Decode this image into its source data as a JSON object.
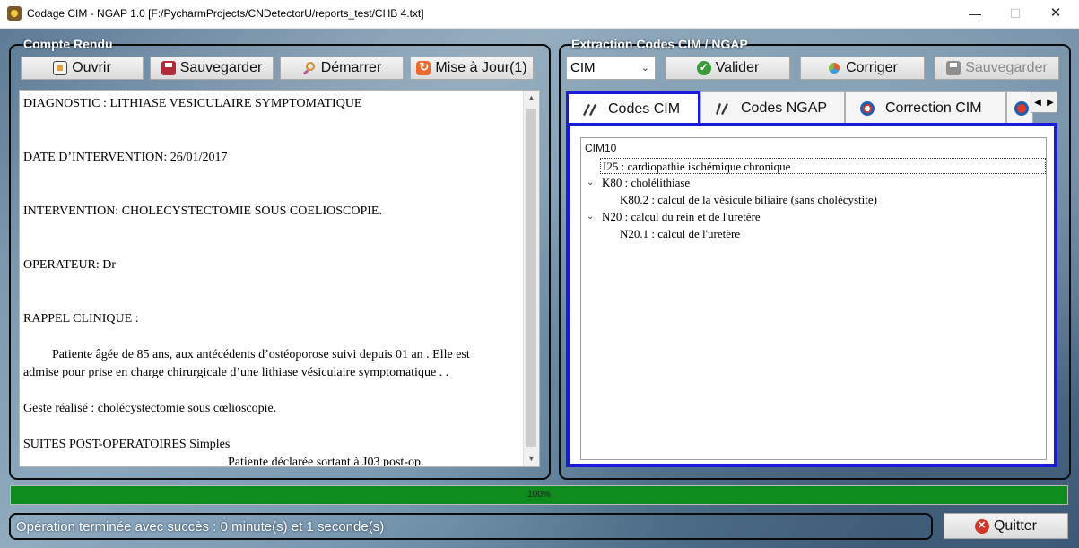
{
  "window": {
    "title": "Codage CIM - NGAP 1.0 [F:/PycharmProjects/CNDetectorU/reports_test/CHB 4.txt]",
    "minimize": "—",
    "maximize": "☐",
    "close": "✕"
  },
  "left_panel": {
    "title": "Compte Rendu",
    "buttons": {
      "open": "Ouvrir",
      "save": "Sauvegarder",
      "start": "Démarrer",
      "update": "Mise à Jour(1)"
    },
    "report_lines": [
      "DIAGNOSTIC : LITHIASE VESICULAIRE SYMPTOMATIQUE",
      "DATE D’INTERVENTION: 26/01/2017",
      "INTERVENTION: CHOLECYSTECTOMIE SOUS COELIOSCOPIE.",
      "OPERATEUR: Dr",
      "RAPPEL CLINIQUE :",
      "Patiente âgée de 85 ans, aux antécédents d’ostéoporose suivi depuis 01 an  . Elle est",
      "admise pour prise en charge chirurgicale d’une lithiase vésiculaire symptomatique .         .",
      "Geste réalisé : cholécystectomie sous cœlioscopie.",
      "SUITES POST-OPERATOIRES Simples",
      "Patiente déclarée sortant à J03 post-op."
    ]
  },
  "right_panel": {
    "title": "Extraction Codes CIM / NGAP",
    "code_type_select": "CIM",
    "buttons": {
      "validate": "Valider",
      "correct": "Corriger",
      "save": "Sauvegarder"
    },
    "tabs": [
      "Codes CIM",
      "Codes NGAP",
      "Correction CIM"
    ],
    "tree": {
      "header": "CIM10",
      "items": [
        "I25 : cardiopathie ischémique chronique",
        "K80 : cholélithiase",
        "K80.2 : calcul de la vésicule biliaire (sans cholécystite)",
        "N20 : calcul du rein et de l'uretère",
        "N20.1 : calcul de l'uretère"
      ]
    }
  },
  "progress": {
    "value": 100,
    "label": "100%",
    "color": "#0f8a1c"
  },
  "status": {
    "message": "Opération terminée avec succès : 0 minute(s) et 1 seconde(s)"
  },
  "quit_button": "Quitter"
}
